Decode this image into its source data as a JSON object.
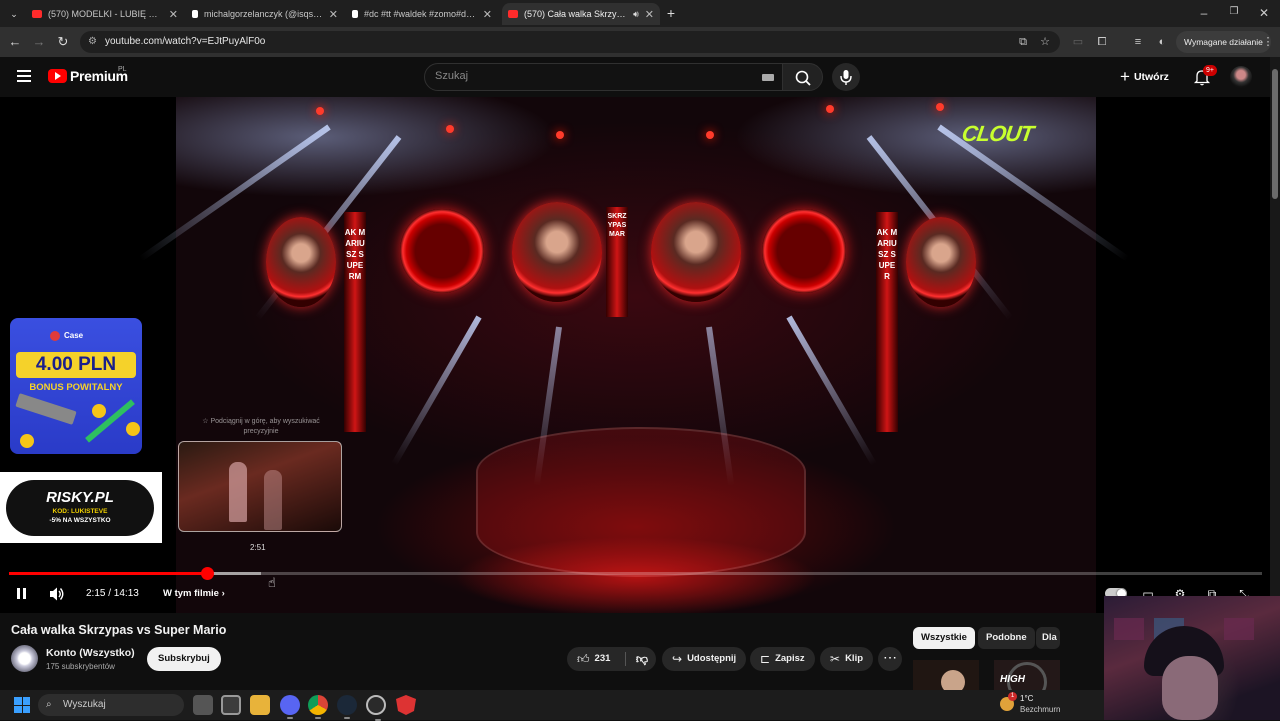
{
  "browser": {
    "tabs": [
      {
        "title": "(570) MODELKI - LUBIĘ CIĘ JAK",
        "favicon": "youtube-icon",
        "color": "#ff2b2b"
      },
      {
        "title": "michalgorzelanczyk (@isqscyg)",
        "favicon": "tiktok-icon",
        "color": "#ffffff"
      },
      {
        "title": "#dc #tt #waldek #zomo#dobro",
        "favicon": "tiktok-icon",
        "color": "#ffffff"
      },
      {
        "title": "(570) Cała walka Skrzypas v",
        "favicon": "youtube-icon",
        "color": "#ff2b2b",
        "active": true,
        "audio_icon": "speaker-icon"
      }
    ],
    "url": "youtube.com/watch?v=EJtPuyAlF0o",
    "required_action_label": "Wymagane działanie"
  },
  "masthead": {
    "logo_text": "Premium",
    "country": "PL",
    "search_placeholder": "Szukaj",
    "create_label": "Utwórz",
    "notification_count": "9+"
  },
  "player": {
    "current_time": "2:15",
    "duration": "14:13",
    "time_display": "2:15 / 14:13",
    "progress_fraction": 0.1583,
    "chapters_label": "W tym filmie",
    "chapters_chevron": "›",
    "preview_time": "2:51",
    "swipe_hint": "☆ Podciągnij w górę, aby wyszukiwać precyzyjnie",
    "overlay_logo": "CLOUT",
    "pillar_left": "AK MARIUSZ SUPERM",
    "pillar_center": "SKRZYPAS MAR",
    "pillar_right": "AK MARIUSZ SUPER",
    "ad_case": {
      "brand": "Case",
      "amount": "4.00 PLN",
      "bonus": "BONUS POWITALNY"
    },
    "ad_risky": {
      "name": "RISKY.PL",
      "code": "KOD: LUKISTEVE",
      "discount": "-5% NA WSZYSTKO"
    }
  },
  "video": {
    "title": "Cała walka Skrzypas vs Super Mario",
    "channel_name": "Konto (Wszystko)",
    "subscribers": "175 subskrybentów",
    "subscribe_label": "Subskrybuj",
    "likes": "231",
    "share_label": "Udostępnij",
    "save_label": "Zapisz",
    "clip_label": "Klip",
    "more_label": "⋯"
  },
  "related": {
    "chips": [
      "Wszystkie",
      "Podobne",
      "Dla"
    ],
    "badge": "HIGH"
  },
  "taskbar": {
    "search_label": "Wyszukaj",
    "weather_temp": "1°C",
    "weather_condition": "Bezchmurn",
    "weather_badge": "1"
  },
  "colors": {
    "accent": "#ff0000",
    "background": "#0f0f0f"
  }
}
